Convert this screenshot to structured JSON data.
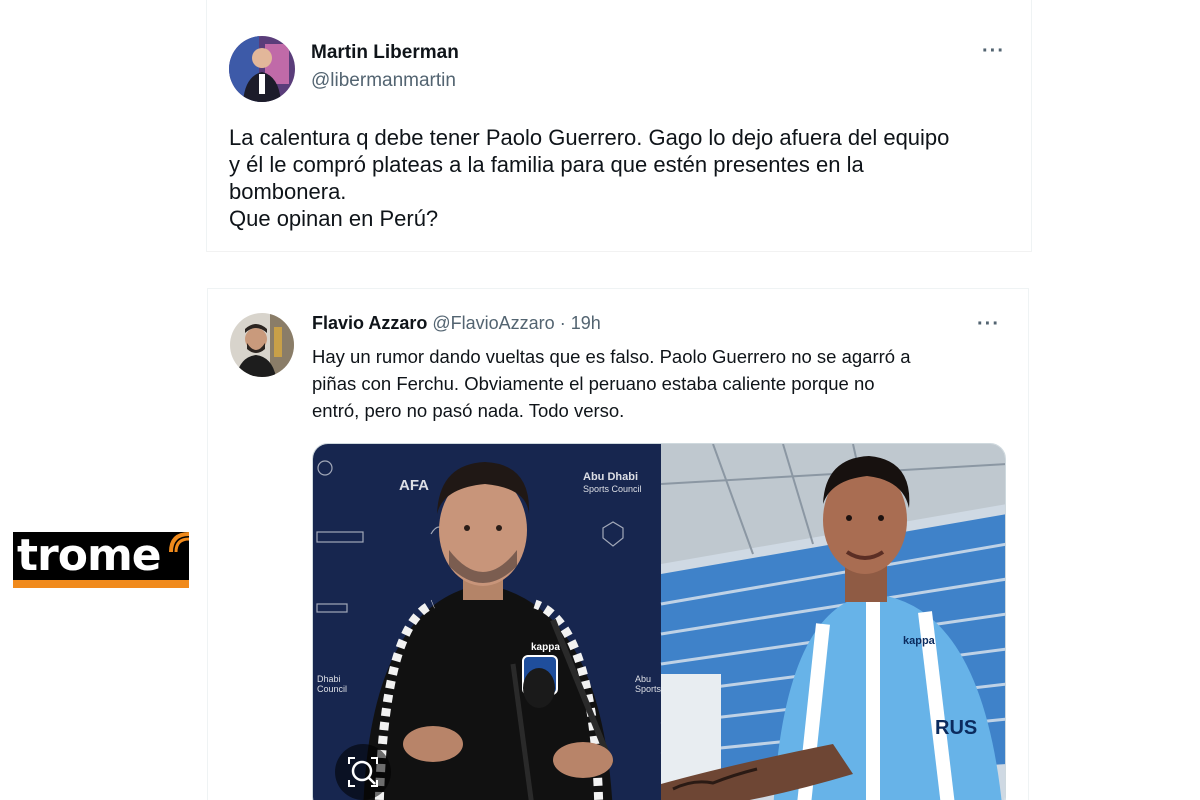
{
  "tweets": [
    {
      "author_name": "Martin Liberman",
      "author_handle": "@libermanmartin",
      "more_label": "···",
      "text_lines": [
        "La calentura q debe tener Paolo Guerrero. Gago lo dejo afuera del equipo",
        "y él le compró plateas a la familia para que estén presentes en la",
        "bombonera.",
        "Que opinan en Perú?"
      ]
    },
    {
      "author_name": "Flavio Azzaro",
      "author_handle": "@FlavioAzzaro",
      "separator": " · ",
      "time": "19h",
      "more_label": "···",
      "text_lines": [
        "Hay un rumor dando vueltas que es falso. Paolo Guerrero no se agarró a",
        "piñas con Ferchu. Obviamente el peruano estaba caliente porque no",
        "entró, pero no pasó nada. Todo verso."
      ],
      "media": {
        "left_panel": {
          "backdrop_text": [
            "Abu Dhabi",
            "Sports Council",
            "AFA",
            "Dhabi",
            "Council",
            "Abu",
            "Sports"
          ],
          "jersey_text": "kappa"
        },
        "right_panel": {
          "jersey_text": [
            "kappa",
            "RUS"
          ]
        }
      }
    }
  ],
  "logo": {
    "text": "trome"
  },
  "colors": {
    "name": "#0f1419",
    "handle": "#536471",
    "border": "#eff3f4",
    "logo_orange": "#f08a1c"
  }
}
